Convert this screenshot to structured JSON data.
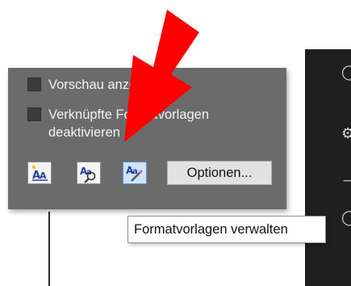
{
  "panel": {
    "checkbox_preview_label": "Vorschau anzeigen",
    "checkbox_linked_label_line1": "Verknüpfte Formatvorlagen",
    "checkbox_linked_label_line2": "deaktivieren",
    "options_button_label": "Optionen..."
  },
  "toolbar": {
    "buttons": [
      {
        "icon": "new-style-icon"
      },
      {
        "icon": "style-inspector-icon"
      },
      {
        "icon": "manage-styles-icon",
        "selected": true
      }
    ]
  },
  "tooltip": {
    "text": "Formatvorlagen verwalten"
  },
  "annotation": {
    "arrow_color": "#ff0000"
  }
}
